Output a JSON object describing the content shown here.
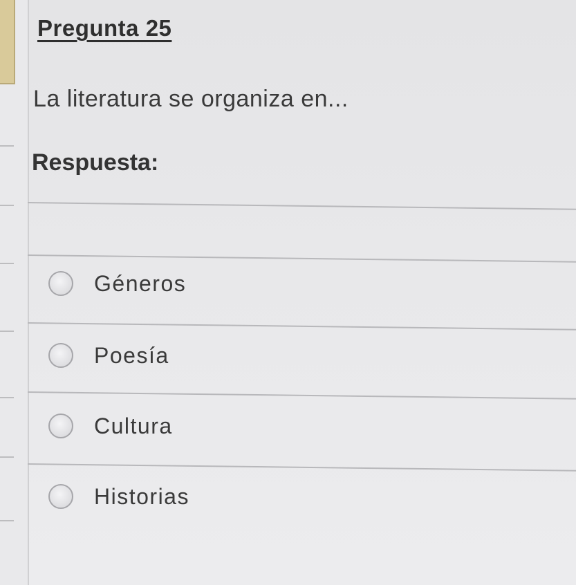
{
  "question": {
    "title": "Pregunta 25",
    "text": "La literatura se organiza en...",
    "answer_label": "Respuesta:"
  },
  "options": [
    {
      "label": "Géneros"
    },
    {
      "label": "Poesía"
    },
    {
      "label": "Cultura"
    },
    {
      "label": "Historias"
    }
  ]
}
